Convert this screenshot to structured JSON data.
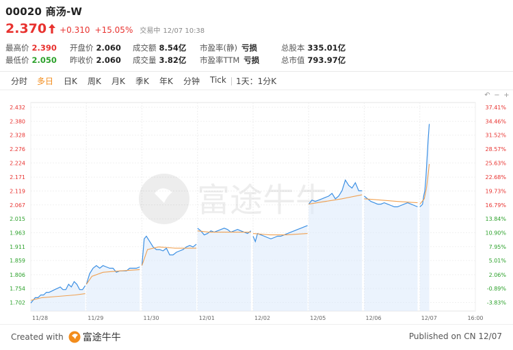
{
  "header": {
    "title": "00020 商汤-W",
    "price": "2.370",
    "change": "+0.310",
    "change_pct": "+15.05%",
    "status": "交易中",
    "time": "12/07 10:38"
  },
  "stats": {
    "high": {
      "label": "最高价",
      "value": "2.390"
    },
    "low": {
      "label": "最低价",
      "value": "2.050"
    },
    "open": {
      "label": "开盘价",
      "value": "2.060"
    },
    "prev_close": {
      "label": "昨收价",
      "value": "2.060"
    },
    "turnover": {
      "label": "成交额",
      "value": "8.54亿"
    },
    "volume": {
      "label": "成交量",
      "value": "3.82亿"
    },
    "pe_static": {
      "label": "市盈率(静)",
      "value": "亏损"
    },
    "pe_ttm": {
      "label": "市盈率TTM",
      "value": "亏损"
    },
    "total_shares": {
      "label": "总股本",
      "value": "335.01亿"
    },
    "market_cap": {
      "label": "总市值",
      "value": "793.97亿"
    }
  },
  "tabs": [
    "分时",
    "多日",
    "日K",
    "周K",
    "月K",
    "季K",
    "年K",
    "分钟",
    "Tick",
    "1天：1分K"
  ],
  "active_tab": "多日",
  "watermark": "富途牛牛",
  "footer": {
    "created_with": "Created with",
    "brand": "富途牛牛",
    "published": "Published on CN 12/07"
  },
  "colors": {
    "up": "#e8322f",
    "down": "#2ca12b",
    "price_line": "#3b8fe3",
    "avg_line": "#f0a050",
    "active_tab": "#f28c1c"
  },
  "chart_data": {
    "type": "line",
    "title": "",
    "xlabel": "",
    "ylabel": "",
    "ylim": [
      1.67,
      2.45
    ],
    "reference_price": 2.06,
    "y_ticks": [
      "2.432",
      "2.380",
      "2.328",
      "2.276",
      "2.224",
      "2.171",
      "2.119",
      "2.067",
      "2.015",
      "1.963",
      "1.911",
      "1.859",
      "1.806",
      "1.754",
      "1.702"
    ],
    "y_tick_values": [
      2.432,
      2.38,
      2.328,
      2.276,
      2.224,
      2.171,
      2.119,
      2.067,
      2.015,
      1.963,
      1.911,
      1.859,
      1.806,
      1.754,
      1.702
    ],
    "pct_ticks": [
      "37.41%",
      "34.46%",
      "31.52%",
      "28.57%",
      "25.63%",
      "22.68%",
      "19.73%",
      "16.79%",
      "13.84%",
      "10.90%",
      "7.95%",
      "5.01%",
      "2.06%",
      "-0.89%",
      "-3.83%"
    ],
    "days": [
      "11/28",
      "11/29",
      "11/30",
      "12/01",
      "12/02",
      "12/05",
      "12/06",
      "12/07"
    ],
    "end_label": "16:00",
    "series": [
      {
        "legend": "price",
        "segments": [
          [
            [
              0,
              1.7
            ],
            [
              0.04,
              1.71
            ],
            [
              0.08,
              1.72
            ],
            [
              0.13,
              1.72
            ],
            [
              0.18,
              1.73
            ],
            [
              0.23,
              1.73
            ],
            [
              0.28,
              1.74
            ],
            [
              0.33,
              1.74
            ],
            [
              0.38,
              1.745
            ],
            [
              0.43,
              1.75
            ],
            [
              0.48,
              1.755
            ],
            [
              0.53,
              1.76
            ],
            [
              0.58,
              1.75
            ],
            [
              0.63,
              1.75
            ],
            [
              0.68,
              1.77
            ],
            [
              0.73,
              1.76
            ],
            [
              0.78,
              1.78
            ],
            [
              0.83,
              1.77
            ],
            [
              0.88,
              1.75
            ],
            [
              0.93,
              1.75
            ],
            [
              0.98,
              1.765
            ]
          ],
          [
            [
              1.0,
              1.77
            ],
            [
              1.06,
              1.81
            ],
            [
              1.12,
              1.83
            ],
            [
              1.18,
              1.84
            ],
            [
              1.24,
              1.83
            ],
            [
              1.3,
              1.84
            ],
            [
              1.36,
              1.835
            ],
            [
              1.42,
              1.83
            ],
            [
              1.48,
              1.83
            ],
            [
              1.54,
              1.815
            ],
            [
              1.6,
              1.82
            ],
            [
              1.66,
              1.82
            ],
            [
              1.72,
              1.82
            ],
            [
              1.78,
              1.83
            ],
            [
              1.84,
              1.83
            ],
            [
              1.9,
              1.83
            ],
            [
              1.96,
              1.835
            ]
          ],
          [
            [
              2.0,
              1.84
            ],
            [
              2.04,
              1.94
            ],
            [
              2.08,
              1.95
            ],
            [
              2.14,
              1.93
            ],
            [
              2.2,
              1.91
            ],
            [
              2.26,
              1.9
            ],
            [
              2.32,
              1.9
            ],
            [
              2.38,
              1.895
            ],
            [
              2.44,
              1.905
            ],
            [
              2.5,
              1.88
            ],
            [
              2.56,
              1.88
            ],
            [
              2.62,
              1.89
            ],
            [
              2.68,
              1.895
            ],
            [
              2.74,
              1.9
            ],
            [
              2.8,
              1.91
            ],
            [
              2.86,
              1.915
            ],
            [
              2.92,
              1.91
            ],
            [
              2.98,
              1.92
            ]
          ],
          [
            [
              3.0,
              1.98
            ],
            [
              3.06,
              1.97
            ],
            [
              3.12,
              1.955
            ],
            [
              3.18,
              1.96
            ],
            [
              3.24,
              1.97
            ],
            [
              3.3,
              1.965
            ],
            [
              3.36,
              1.97
            ],
            [
              3.42,
              1.975
            ],
            [
              3.48,
              1.98
            ],
            [
              3.54,
              1.975
            ],
            [
              3.6,
              1.965
            ],
            [
              3.66,
              1.97
            ],
            [
              3.72,
              1.975
            ],
            [
              3.78,
              1.97
            ],
            [
              3.84,
              1.965
            ],
            [
              3.9,
              1.96
            ],
            [
              3.96,
              1.97
            ]
          ],
          [
            [
              4.0,
              1.95
            ],
            [
              4.04,
              1.93
            ],
            [
              4.08,
              1.96
            ],
            [
              4.14,
              1.955
            ],
            [
              4.2,
              1.95
            ],
            [
              4.26,
              1.945
            ],
            [
              4.32,
              1.94
            ],
            [
              4.38,
              1.945
            ],
            [
              4.44,
              1.95
            ],
            [
              4.5,
              1.95
            ],
            [
              4.56,
              1.955
            ],
            [
              4.62,
              1.96
            ],
            [
              4.68,
              1.965
            ],
            [
              4.74,
              1.97
            ],
            [
              4.8,
              1.975
            ],
            [
              4.86,
              1.98
            ],
            [
              4.92,
              1.985
            ],
            [
              4.98,
              1.99
            ]
          ],
          [
            [
              5.0,
              2.07
            ],
            [
              5.06,
              2.085
            ],
            [
              5.12,
              2.08
            ],
            [
              5.18,
              2.085
            ],
            [
              5.24,
              2.09
            ],
            [
              5.3,
              2.095
            ],
            [
              5.36,
              2.1
            ],
            [
              5.42,
              2.11
            ],
            [
              5.48,
              2.09
            ],
            [
              5.54,
              2.1
            ],
            [
              5.6,
              2.12
            ],
            [
              5.66,
              2.16
            ],
            [
              5.72,
              2.14
            ],
            [
              5.78,
              2.13
            ],
            [
              5.84,
              2.15
            ],
            [
              5.9,
              2.12
            ],
            [
              5.96,
              2.12
            ]
          ],
          [
            [
              6.0,
              2.1
            ],
            [
              6.06,
              2.09
            ],
            [
              6.12,
              2.08
            ],
            [
              6.18,
              2.075
            ],
            [
              6.24,
              2.07
            ],
            [
              6.3,
              2.07
            ],
            [
              6.36,
              2.075
            ],
            [
              6.42,
              2.07
            ],
            [
              6.48,
              2.065
            ],
            [
              6.54,
              2.06
            ],
            [
              6.6,
              2.06
            ],
            [
              6.66,
              2.065
            ],
            [
              6.72,
              2.07
            ],
            [
              6.78,
              2.075
            ],
            [
              6.84,
              2.07
            ],
            [
              6.9,
              2.065
            ],
            [
              6.96,
              2.06
            ]
          ],
          [
            [
              7.0,
              2.06
            ],
            [
              7.03,
              2.065
            ],
            [
              7.05,
              2.07
            ],
            [
              7.07,
              2.1
            ],
            [
              7.09,
              2.12
            ],
            [
              7.11,
              2.17
            ],
            [
              7.13,
              2.24
            ],
            [
              7.15,
              2.31
            ],
            [
              7.17,
              2.37
            ]
          ]
        ]
      },
      {
        "legend": "average",
        "segments": [
          [
            [
              0,
              1.71
            ],
            [
              0.2,
              1.72
            ],
            [
              0.5,
              1.725
            ],
            [
              0.8,
              1.73
            ],
            [
              0.98,
              1.735
            ]
          ],
          [
            [
              1.0,
              1.77
            ],
            [
              1.1,
              1.8
            ],
            [
              1.3,
              1.815
            ],
            [
              1.6,
              1.82
            ],
            [
              1.96,
              1.825
            ]
          ],
          [
            [
              2.0,
              1.84
            ],
            [
              2.1,
              1.9
            ],
            [
              2.3,
              1.91
            ],
            [
              2.6,
              1.905
            ],
            [
              2.98,
              1.905
            ]
          ],
          [
            [
              3.0,
              1.97
            ],
            [
              3.2,
              1.965
            ],
            [
              3.5,
              1.965
            ],
            [
              3.96,
              1.965
            ]
          ],
          [
            [
              4.0,
              1.96
            ],
            [
              4.3,
              1.955
            ],
            [
              4.6,
              1.955
            ],
            [
              4.98,
              1.96
            ]
          ],
          [
            [
              5.0,
              2.07
            ],
            [
              5.3,
              2.08
            ],
            [
              5.6,
              2.09
            ],
            [
              5.96,
              2.105
            ]
          ],
          [
            [
              6.0,
              2.09
            ],
            [
              6.3,
              2.085
            ],
            [
              6.6,
              2.08
            ],
            [
              6.96,
              2.075
            ]
          ],
          [
            [
              7.0,
              2.07
            ],
            [
              7.08,
              2.09
            ],
            [
              7.12,
              2.13
            ],
            [
              7.15,
              2.18
            ],
            [
              7.17,
              2.22
            ]
          ]
        ]
      }
    ]
  }
}
